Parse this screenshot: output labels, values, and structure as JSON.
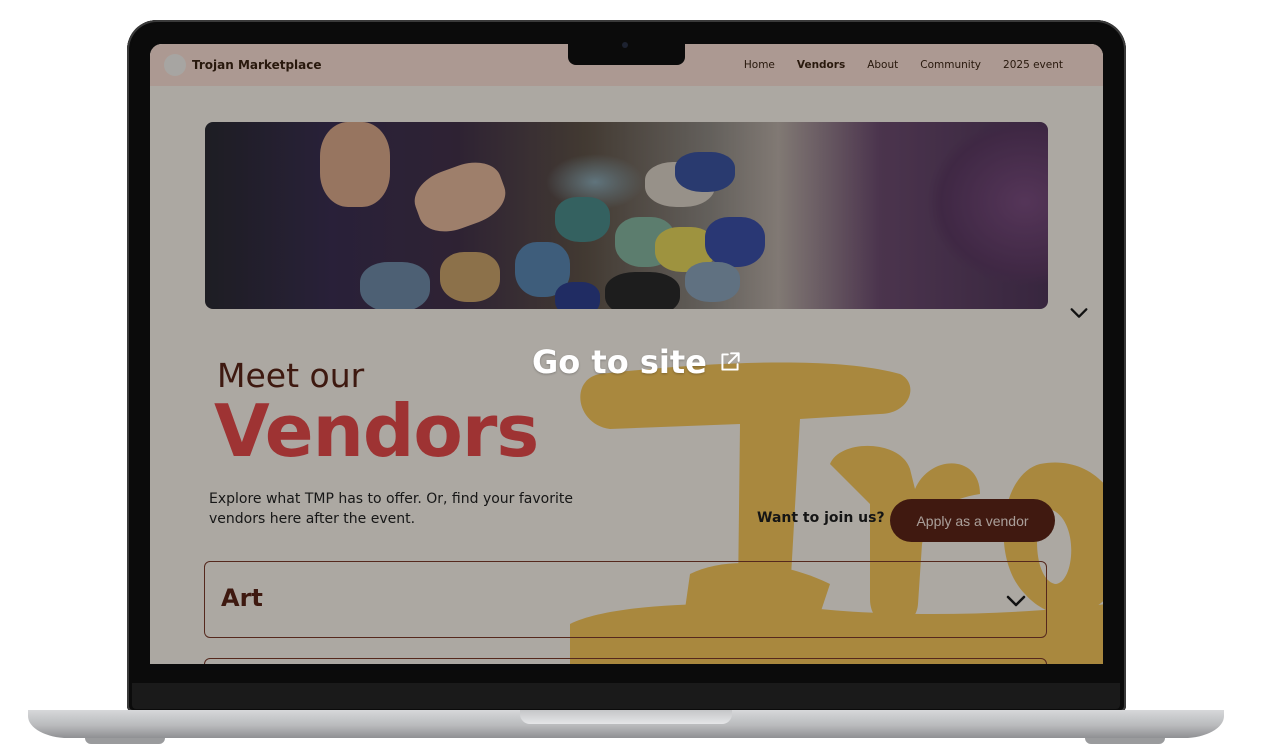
{
  "site": {
    "brand": "Trojan Marketplace",
    "nav": [
      "Home",
      "Vendors",
      "About",
      "Community",
      "2025 event"
    ],
    "active_nav": "Vendors"
  },
  "hero": {
    "image": "pottery-market-photo"
  },
  "overlay": {
    "goto_label": "Go to site",
    "goto_icon": "external-link-icon"
  },
  "heading": {
    "line1": "Meet our",
    "line2": "Vendors"
  },
  "description": "Explore what TMP has to offer. Or, find your favorite vendors here after the event.",
  "join": {
    "label": "Want to join us?",
    "button": "Apply as a vendor"
  },
  "categories": [
    "Art"
  ],
  "colors": {
    "accent_red": "#e3494a",
    "brown": "#5c2517",
    "nav_bg": "#f7dcd1",
    "watermark": "#f2c35a"
  }
}
